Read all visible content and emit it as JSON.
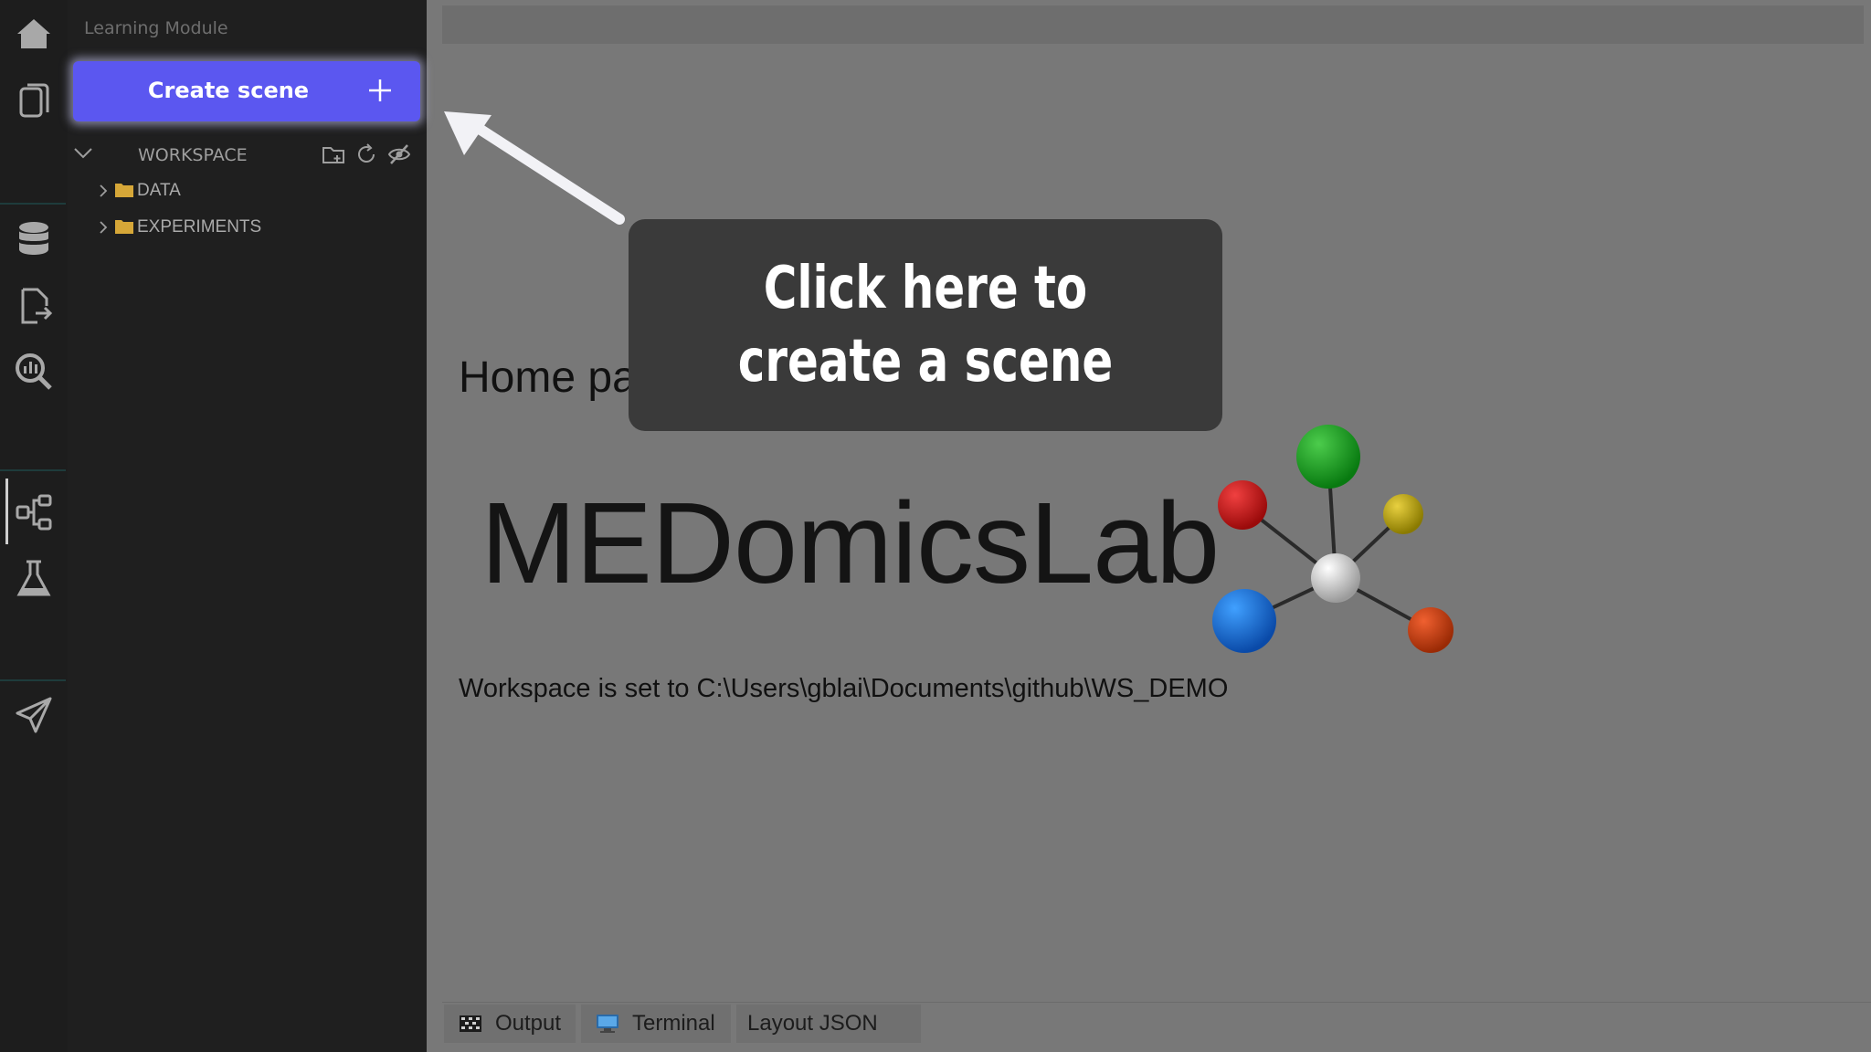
{
  "activity_bar": {
    "items": [
      {
        "name": "home-icon"
      },
      {
        "name": "pages-icon"
      },
      {
        "name": "database-icon"
      },
      {
        "name": "file-export-icon"
      },
      {
        "name": "analytics-search-icon"
      },
      {
        "name": "flow-diagram-icon"
      },
      {
        "name": "flask-icon"
      },
      {
        "name": "send-icon"
      }
    ]
  },
  "sidebar": {
    "title": "Learning Module",
    "create_button": {
      "label": "Create scene",
      "icon": "plus-icon",
      "color": "#5b57f0"
    },
    "workspace": {
      "label": "WORKSPACE",
      "tools": [
        "new-folder-icon",
        "refresh-icon",
        "hide-icon"
      ],
      "items": [
        {
          "label": "DATA",
          "icon": "folder-icon"
        },
        {
          "label": "EXPERIMENTS",
          "icon": "folder-icon"
        }
      ]
    }
  },
  "main": {
    "title": "Home page",
    "brand": "MEDomicsLab",
    "workspace_path": "Workspace is set to C:\\Users\\gblai\\Documents\\github\\WS_DEMO"
  },
  "tooltip": {
    "text": "Click here to create a scene"
  },
  "bottom_panel": {
    "tabs": [
      {
        "label": "Output",
        "icon": "output-icon"
      },
      {
        "label": "Terminal",
        "icon": "terminal-icon"
      },
      {
        "label": "Layout JSON"
      }
    ]
  }
}
